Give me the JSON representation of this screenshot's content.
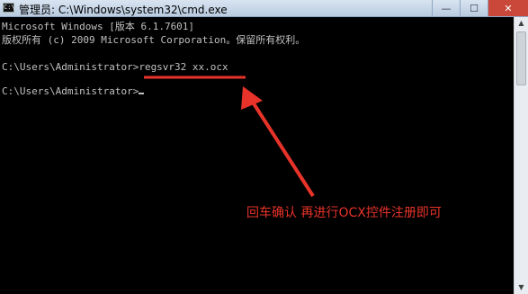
{
  "window": {
    "title": "管理员: C:\\Windows\\system32\\cmd.exe",
    "app_icon_text": "C:\\",
    "buttons": {
      "minimize": "—",
      "maximize": "☐",
      "close": "✕"
    }
  },
  "console": {
    "lines": [
      "Microsoft Windows [版本 6.1.7601]",
      "版权所有 (c) 2009 Microsoft Corporation。保留所有权利。",
      "",
      "C:\\Users\\Administrator>regsvr32 xx.ocx",
      "",
      "C:\\Users\\Administrator>"
    ]
  },
  "annotation": {
    "text": "回车确认 再进行OCX控件注册即可",
    "color": "#e8332a"
  },
  "colors": {
    "console_bg": "#000000",
    "console_fg": "#c0c0c0",
    "accent": "#e8332a"
  }
}
